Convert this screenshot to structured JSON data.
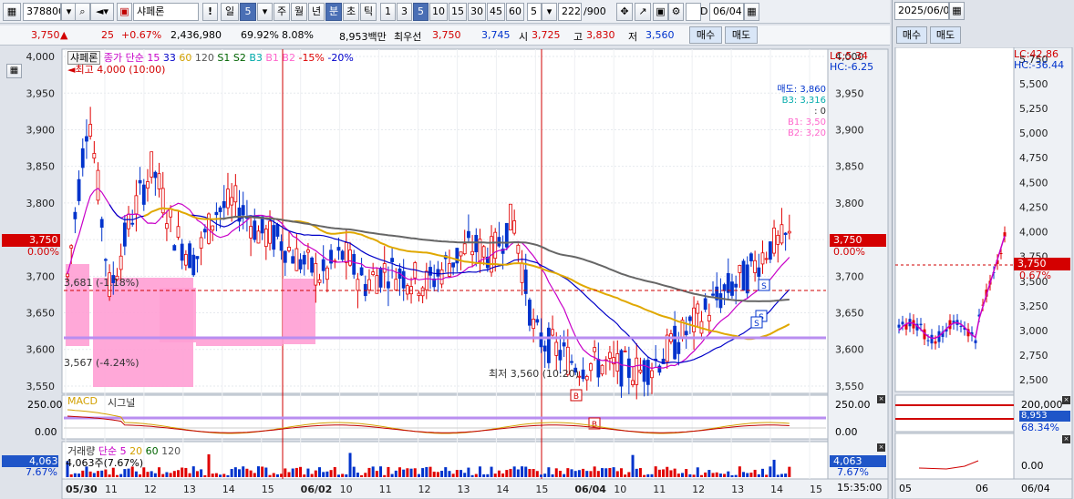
{
  "toolbar": {
    "code": "378800",
    "name": "샤페론",
    "excl": "!",
    "period_day": "일",
    "period_val": "5",
    "periods": [
      "주",
      "월",
      "년",
      "분",
      "초",
      "틱"
    ],
    "minutes": [
      "1",
      "3",
      "5",
      "10",
      "15",
      "30",
      "45",
      "60"
    ],
    "interval": "5",
    "count": "222",
    "count_total": "/900",
    "date_label": "D",
    "date_value": "06/04"
  },
  "info": {
    "price": "3,750",
    "change_arrow": "▲",
    "change": "25",
    "change_pct": "+0.67%",
    "volume": "2,436,980",
    "vol_ratio": "69.92%",
    "turnover": "8.08%",
    "amount": "8,953백만",
    "ask_label": "최우선",
    "ask1": "3,750",
    "bid1": "3,745",
    "open_label": "시",
    "open": "3,725",
    "high_label": "고",
    "high": "3,830",
    "low_label": "저",
    "low": "3,560",
    "buy": "매수",
    "sell": "매도"
  },
  "main_chart": {
    "legend_name": "샤페론",
    "legend_items": [
      "종가 단순 15",
      "33",
      "60",
      "120",
      "S1",
      "S2",
      "B3",
      "B1",
      "B2",
      "-15%",
      "-20%"
    ],
    "legend_colors": [
      "#c800c8",
      "#0000c8",
      "#d2a000",
      "#555555",
      "#006400",
      "#006400",
      "#00aaaa",
      "#ff66cc",
      "#ff66cc",
      "#dd0000",
      "#0000cc"
    ],
    "lc": "LC:5.34",
    "hc": "HC:-6.25",
    "max_note": "최고 4,000 (10:00)",
    "min_note": "최저 3,560 (10:20)",
    "line1_label": "3,681 (-1.18%)",
    "line2_label": "3,567 (-4.24%)",
    "right_info": [
      "매도: 3,860",
      "B3: 3,316",
      ": 0",
      "B1: 3,50",
      "B2: 3,20"
    ],
    "price_tag": "3,750",
    "pct_tag": "0.00%",
    "y_ticks": [
      "4,000",
      "3,950",
      "3,900",
      "3,850",
      "3,800",
      "3,750",
      "3,700",
      "3,650",
      "3,600",
      "3,550"
    ]
  },
  "macd": {
    "title": "MACD",
    "signal": "시그널",
    "ticks": [
      "250.00",
      "0.00"
    ]
  },
  "volume": {
    "title": "거래량",
    "legend": [
      "단순 5",
      "20",
      "60",
      "120"
    ],
    "note": "4,063주(7.67%)",
    "tag": "4,063",
    "tag_pct": "7.67%"
  },
  "x_axis": [
    "05/30",
    "11",
    "12",
    "13",
    "14",
    "15",
    "06/02",
    "10",
    "11",
    "12",
    "13",
    "14",
    "15",
    "06/04",
    "10",
    "11",
    "12",
    "13",
    "14",
    "15"
  ],
  "time_readout": "15:35:00",
  "right_panel": {
    "date": "2025/06/04",
    "buy": "매수",
    "sell": "매도",
    "lc": "LC:42.86",
    "hc": "HC:-36.44",
    "y_ticks": [
      "5,750",
      "5,500",
      "5,250",
      "5,000",
      "4,750",
      "4,500",
      "4,250",
      "4,000",
      "3,750",
      "3,500",
      "3,250",
      "3,000",
      "2,750",
      "2,500"
    ],
    "price_tag": "3,750",
    "pct_tag": "0.67%",
    "vol_ticks": [
      "200,000",
      "8,953",
      "68.34%"
    ],
    "macd_tick": "0.00",
    "x_labels": [
      "05",
      "06",
      "06/04"
    ]
  },
  "chart_data": {
    "type": "line",
    "title": "",
    "ylim": [
      3540,
      4010
    ],
    "series": [
      {
        "name": "종가",
        "values": [
          3700,
          3930,
          3680,
          3780,
          3850,
          3760,
          3720,
          3790,
          3800,
          3760,
          3750,
          3720,
          3700,
          3730,
          3690,
          3710,
          3700,
          3690,
          3720,
          3740,
          3730,
          3780,
          3620,
          3600,
          3580,
          3580,
          3575,
          3570,
          3590,
          3620,
          3650,
          3680,
          3700,
          3740,
          3750
        ]
      }
    ]
  }
}
